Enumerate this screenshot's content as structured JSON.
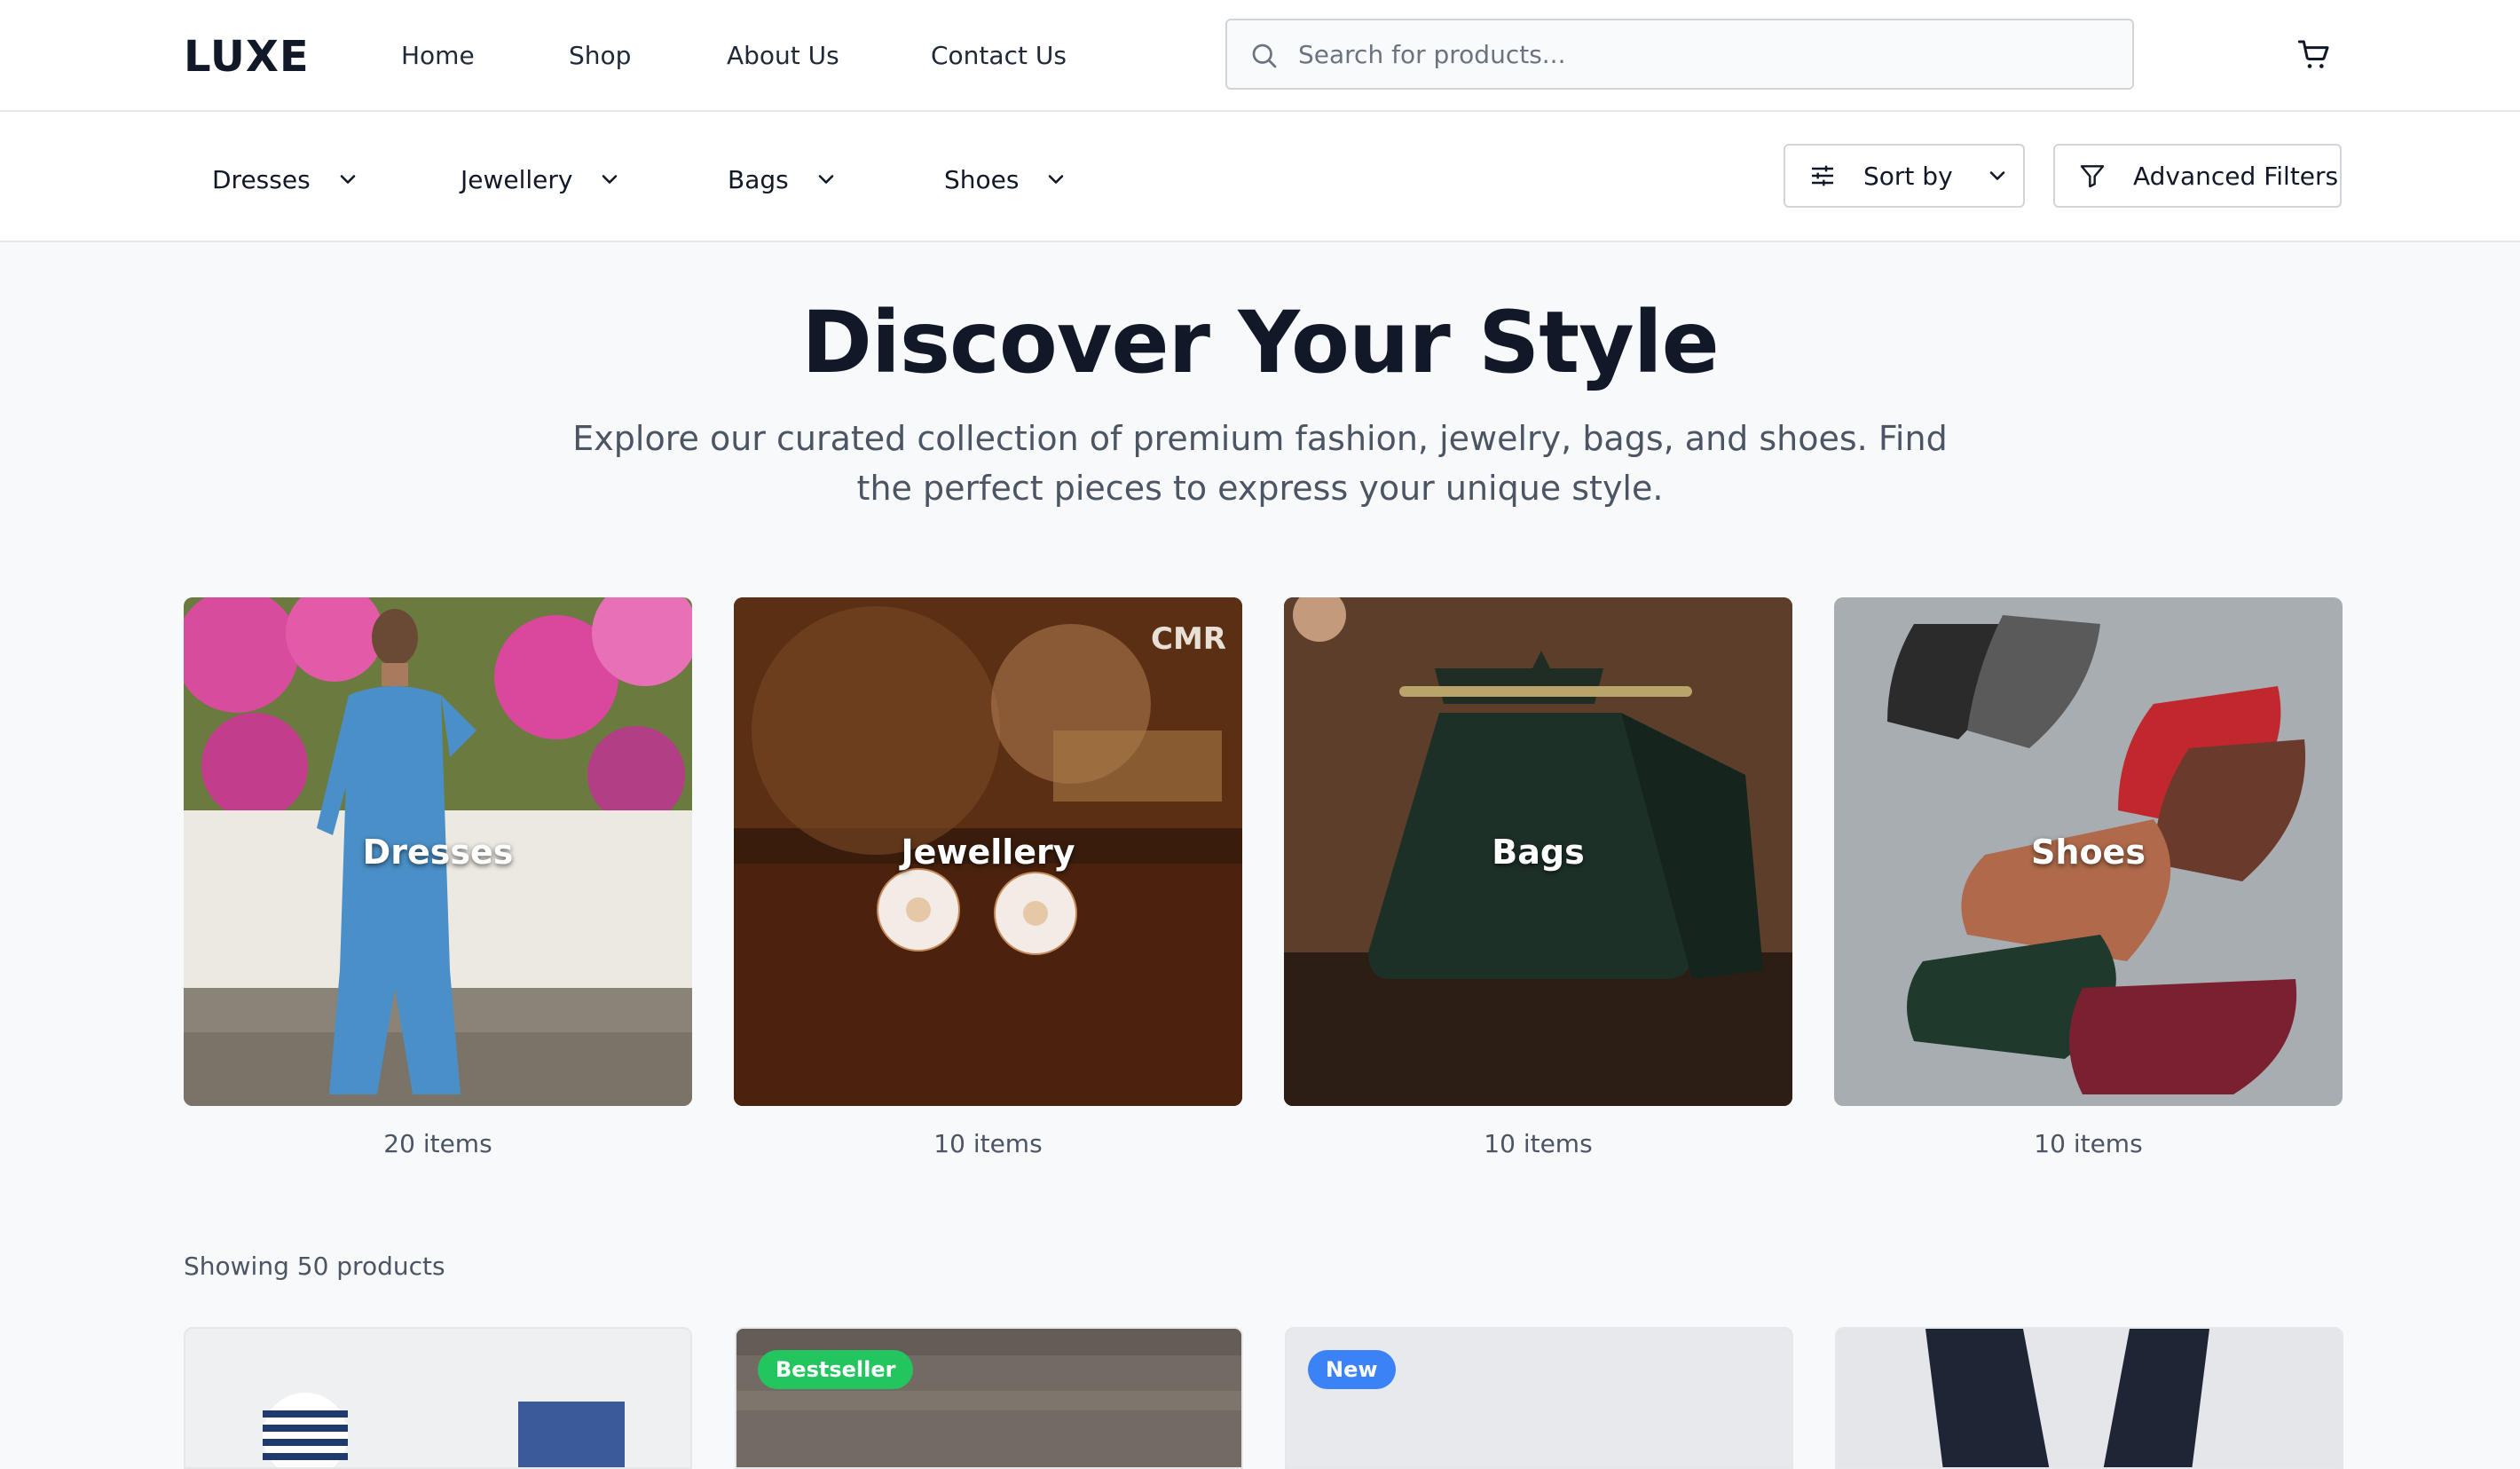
{
  "brand": "LUXE",
  "nav": [
    {
      "label": "Home"
    },
    {
      "label": "Shop"
    },
    {
      "label": "About Us"
    },
    {
      "label": "Contact Us"
    }
  ],
  "search": {
    "placeholder": "Search for products...",
    "value": ""
  },
  "categories_menu": [
    {
      "label": "Dresses"
    },
    {
      "label": "Jewellery"
    },
    {
      "label": "Bags"
    },
    {
      "label": "Shoes"
    }
  ],
  "toolbar": {
    "sort_label": "Sort by",
    "filters_label": "Advanced Filters"
  },
  "hero": {
    "title": "Discover Your Style",
    "subtitle": "Explore our curated collection of premium fashion, jewelry, bags, and shoes. Find the perfect pieces to express your unique style."
  },
  "category_cards": [
    {
      "label": "Dresses",
      "count": "20 items"
    },
    {
      "label": "Jewellery",
      "count": "10 items",
      "watermark": "CMR"
    },
    {
      "label": "Bags",
      "count": "10 items"
    },
    {
      "label": "Shoes",
      "count": "10 items"
    }
  ],
  "results": {
    "showing": "Showing 50 products"
  },
  "products": [
    {
      "badge": ""
    },
    {
      "badge": "Bestseller",
      "badge_color": "#22c55e"
    },
    {
      "badge": "New",
      "badge_color": "#3b82f6"
    },
    {
      "badge": ""
    }
  ],
  "colors": {
    "accent": "#111827",
    "muted": "#4b5563",
    "border": "#e5e7eb",
    "bestseller": "#22c55e",
    "new": "#3b82f6"
  }
}
